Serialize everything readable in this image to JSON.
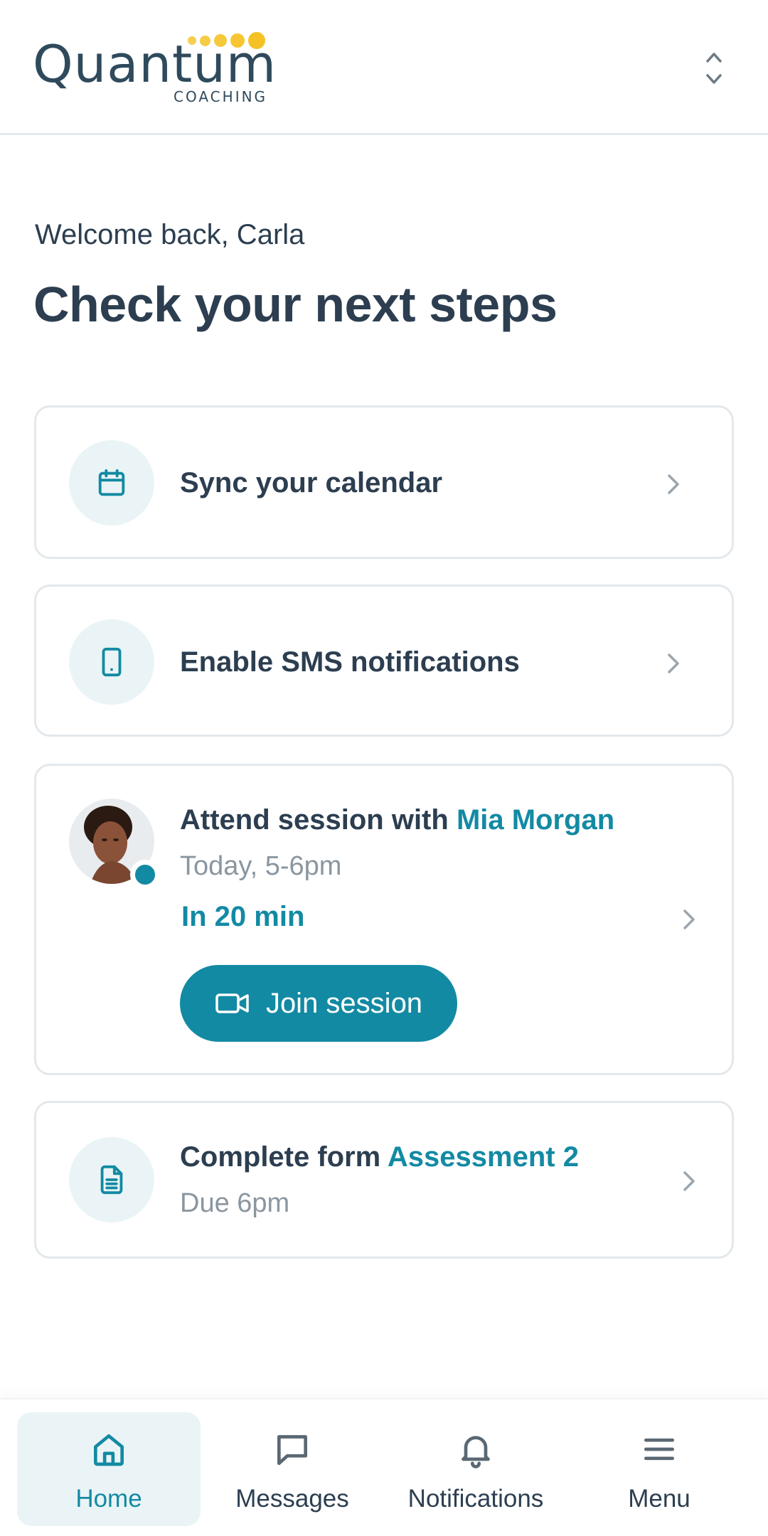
{
  "header": {
    "logo_word": "Quantum",
    "logo_sub": "COACHING",
    "brand_accent": "#f5c226",
    "switcher_icon": "chevron-up-down-icon"
  },
  "greeting": {
    "welcome": "Welcome back, Carla",
    "title": "Check your next steps"
  },
  "steps": {
    "calendar": {
      "label": "Sync your calendar",
      "icon": "calendar-icon"
    },
    "sms": {
      "label": "Enable SMS notifications",
      "icon": "phone-icon"
    },
    "session": {
      "label_prefix": "Attend session with",
      "coach": "Mia Morgan",
      "time": "Today, 5-6pm",
      "countdown": "In 20 min",
      "join_label": "Join session",
      "status": "online"
    },
    "form": {
      "label_prefix": "Complete form",
      "form_name": "Assessment 2",
      "due": "Due 6pm",
      "icon": "document-icon"
    }
  },
  "nav": {
    "items": [
      {
        "label": "Home",
        "icon": "home-icon",
        "active": true
      },
      {
        "label": "Messages",
        "icon": "chat-icon",
        "active": false
      },
      {
        "label": "Notifications",
        "icon": "bell-icon",
        "active": false
      },
      {
        "label": "Menu",
        "icon": "hamburger-icon",
        "active": false
      }
    ]
  },
  "colors": {
    "accent": "#138aa3",
    "text": "#2c3e50",
    "muted": "#8a96a0",
    "border": "#e3e8ec",
    "icon_bg": "#eaf4f6"
  }
}
